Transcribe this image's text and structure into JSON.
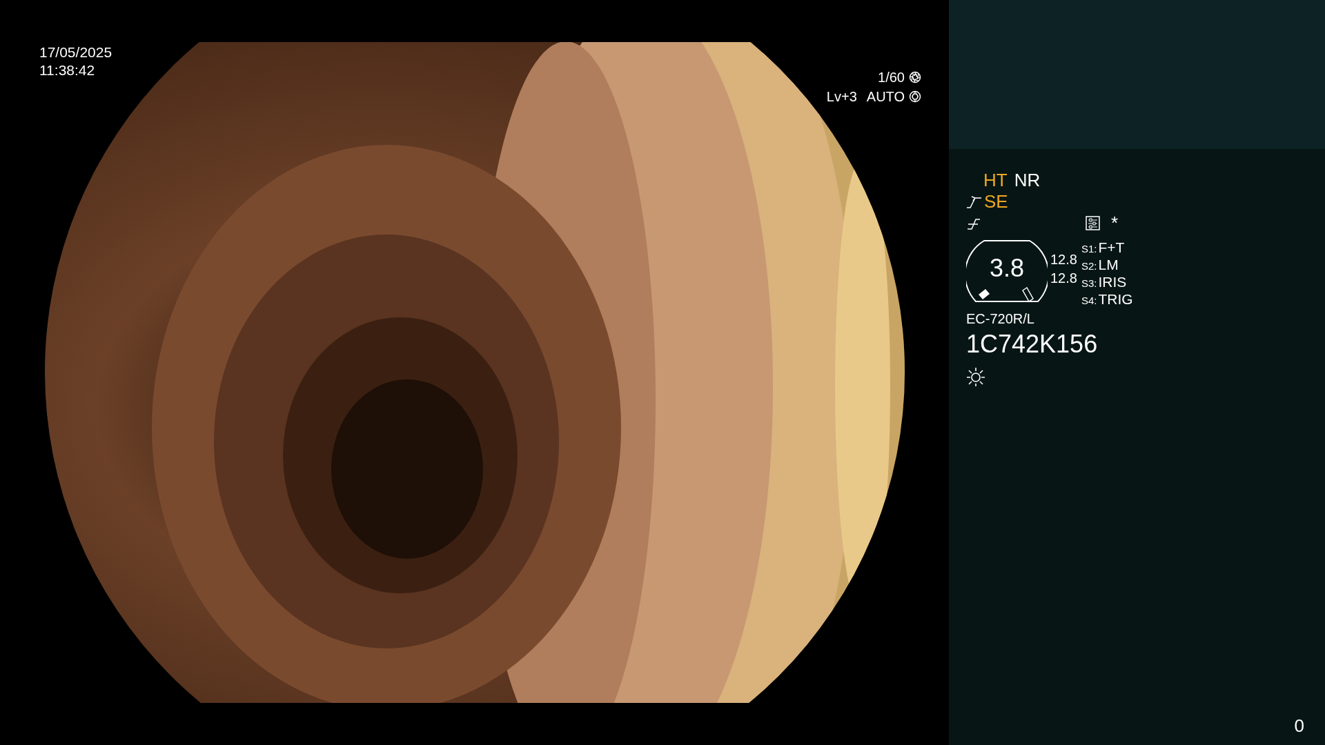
{
  "video": {
    "date": "17/05/2025",
    "time": "11:38:42",
    "shutter": "1/60",
    "exposure_level": "Lv+3",
    "iris_mode": "AUTO"
  },
  "panel": {
    "modes": [
      {
        "label": "HT",
        "on": true
      },
      {
        "label": "NR",
        "on": false
      }
    ],
    "structure": {
      "label": "SE",
      "on": true
    },
    "marker": "*",
    "gauge": {
      "value": "3.8"
    },
    "readings": [
      "12.8",
      "12.8"
    ],
    "switches": [
      {
        "key": "S1:",
        "value": "F+T"
      },
      {
        "key": "S2:",
        "value": "LM"
      },
      {
        "key": "S3:",
        "value": "IRIS"
      },
      {
        "key": "S4:",
        "value": "TRIG"
      }
    ],
    "scope_model": "EC-720R/L",
    "serial": "1C742K156"
  },
  "counter": "0"
}
